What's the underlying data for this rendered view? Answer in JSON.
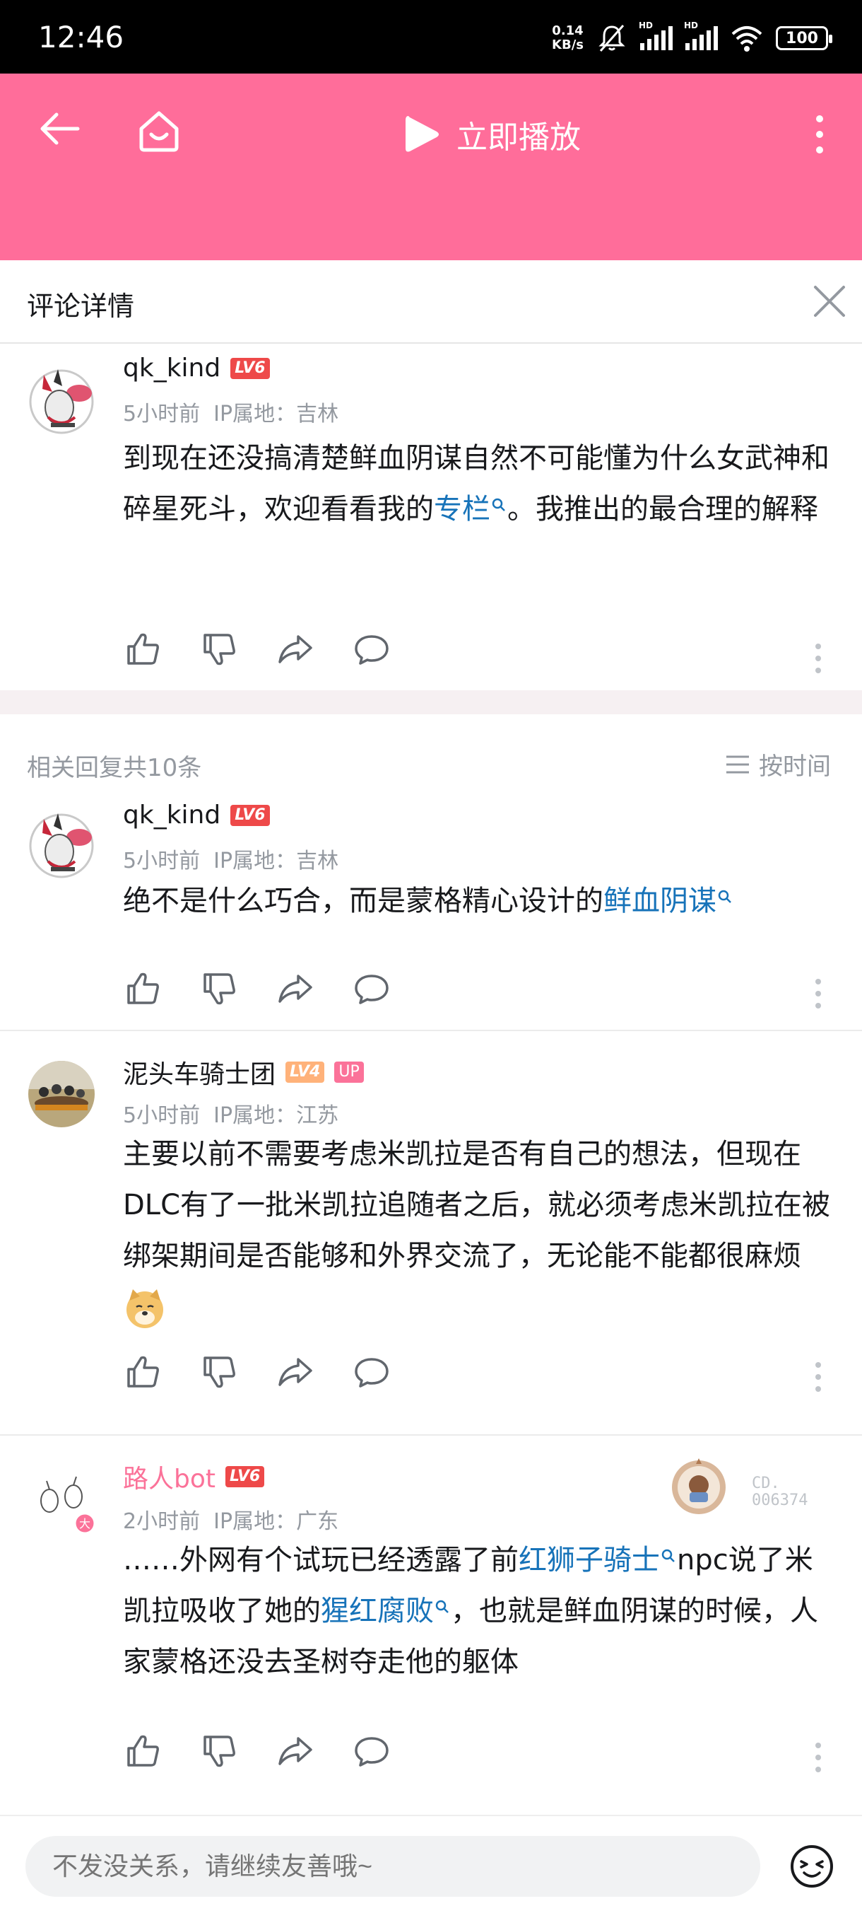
{
  "status_bar": {
    "time": "12:46",
    "net_speed_value": "0.14",
    "net_speed_unit": "KB/s",
    "battery": "100",
    "hd_label": "HD"
  },
  "app_bar": {
    "play_label": "立即播放"
  },
  "detail": {
    "title": "评论详情"
  },
  "root_comment": {
    "user": "qk_kind",
    "level": "LV6",
    "time": "5小时前",
    "ip": "IP属地：吉林",
    "text_1": "到现在还没搞清楚鲜血阴谋自然不可能懂为什么女武神和碎星死斗，欢迎看看我的",
    "link_1": "专栏",
    "text_2": "。我推出的最合理的解释"
  },
  "replies": {
    "count_label": "相关回复共10条",
    "sort_label": "按时间",
    "items": [
      {
        "user": "qk_kind",
        "level": "LV6",
        "time": "5小时前",
        "ip": "IP属地：吉林",
        "text_1": "绝不是什么巧合，而是蒙格精心设计的",
        "link_1": "鲜血阴谋"
      },
      {
        "user": "泥头车骑士团",
        "level": "LV4",
        "up_badge": "UP",
        "time": "5小时前",
        "ip": "IP属地：江苏",
        "text_1": "主要以前不需要考虑米凯拉是否有自己的想法，但现在DLC有了一批米凯拉追随者之后，就必须考虑米凯拉在被绑架期间是否能够和外界交流了，无论能不能都很麻烦",
        "emoji": "doge"
      },
      {
        "user": "路人bot",
        "level": "LV6",
        "time": "2小时前",
        "ip": "IP属地：广东",
        "fans_label": "CD.",
        "fans_no": "006374",
        "text_1": "……外网有个试玩已经透露了前",
        "link_1": "红狮子骑士",
        "text_2": "npc说了米凯拉吸收了她的",
        "link_2": "猩红腐败",
        "text_3": "，也就是鲜血阴谋的时候，人家蒙格还没去圣树夺走他的躯体"
      }
    ]
  },
  "input": {
    "placeholder": "不发没关系，请继续友善哦~"
  },
  "colors": {
    "accent": "#ff6d9a",
    "link": "#1773b9",
    "meta": "#9499a0",
    "level": "#ee4949"
  }
}
